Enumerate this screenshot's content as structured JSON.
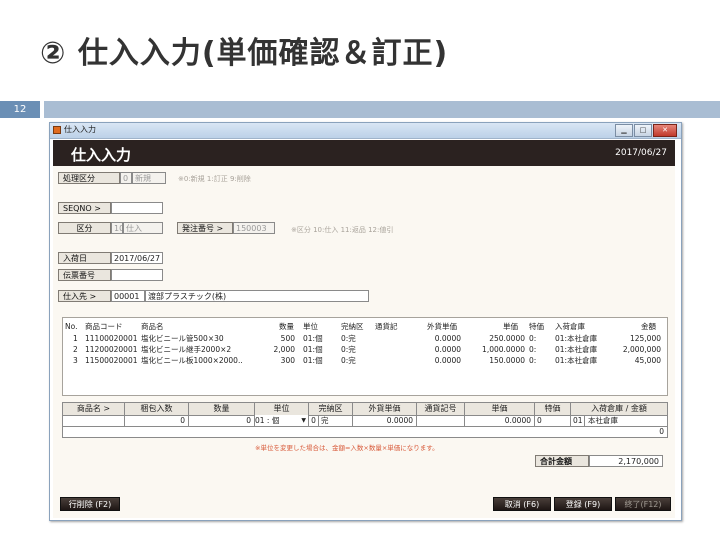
{
  "slide": {
    "title": "② 仕入入力(単価確認＆訂正)",
    "page_number": "12"
  },
  "window": {
    "title": "仕入入力",
    "controls": {
      "minimize": "▁",
      "maximize": "□",
      "close": "✕"
    }
  },
  "header": {
    "title": "仕入入力",
    "date": "2017/06/27"
  },
  "form": {
    "process_type": {
      "label": "処理区分",
      "code": "0",
      "name": "新規",
      "hint": "※0:新規 1:訂正 9:削除"
    },
    "seqno": {
      "label": "SEQNO >",
      "value": ""
    },
    "category": {
      "label": "区分",
      "code": "10",
      "name": "仕入",
      "hint": "※区分 10:仕入 11:返品 12:値引"
    },
    "order_no": {
      "label": "発注番号 >",
      "value": "150003"
    },
    "arrival_date": {
      "label": "入荷日",
      "value": "2017/06/27"
    },
    "slip_no": {
      "label": "伝票番号",
      "value": ""
    },
    "supplier": {
      "label": "仕入先 >",
      "code": "00001",
      "name": "渡部プラスチック(株)"
    }
  },
  "grid": {
    "columns": [
      "No.",
      "商品コード",
      "商品名",
      "数量",
      "単位",
      "完納区",
      "通貨記",
      "外貨単価",
      "単価",
      "特価",
      "入荷倉庫",
      "金額"
    ],
    "rows": [
      {
        "no": "1",
        "code": "11100020001",
        "name": "塩化ビニール管500×30",
        "qty": "500",
        "unit": "01:個",
        "done": "0:完",
        "currency": "",
        "fx_price": "0.0000",
        "price": "250.0000",
        "special": "0:",
        "warehouse": "01:本社倉庫",
        "amount": "125,000"
      },
      {
        "no": "2",
        "code": "11200020001",
        "name": "塩化ビニール継手2000×2",
        "qty": "2,000",
        "unit": "01:個",
        "done": "0:完",
        "currency": "",
        "fx_price": "0.0000",
        "price": "1,000.0000",
        "special": "0:",
        "warehouse": "01:本社倉庫",
        "amount": "2,000,000"
      },
      {
        "no": "3",
        "code": "11500020001",
        "name": "塩化ビニール板1000×2000..",
        "qty": "300",
        "unit": "01:個",
        "done": "0:完",
        "currency": "",
        "fx_price": "0.0000",
        "price": "150.0000",
        "special": "0:",
        "warehouse": "01:本社倉庫",
        "amount": "45,000"
      }
    ]
  },
  "entry": {
    "columns": [
      "商品名 >",
      "梱包入数",
      "数量",
      "単位",
      "完納区",
      "外貨単価",
      "通貨記号",
      "単価",
      "特価",
      "入荷倉庫 / 金額"
    ],
    "pack_qty": "0",
    "qty": "0",
    "unit": "01 : 個",
    "done_code": "0",
    "done_name": "完",
    "fx_price": "0.0000",
    "price": "0.0000",
    "special": "0",
    "warehouse_code": "01",
    "warehouse_name": "本社倉庫",
    "amount": "0"
  },
  "note": "※単位を変更した場合は、金額=入数×数量×単価になります。",
  "total": {
    "label": "合計金額",
    "value": "2,170,000"
  },
  "buttons": {
    "delete_row": "行削除 (F2)",
    "cancel": "取消 (F6)",
    "register": "登録 (F9)",
    "close": "終了(F12)"
  }
}
